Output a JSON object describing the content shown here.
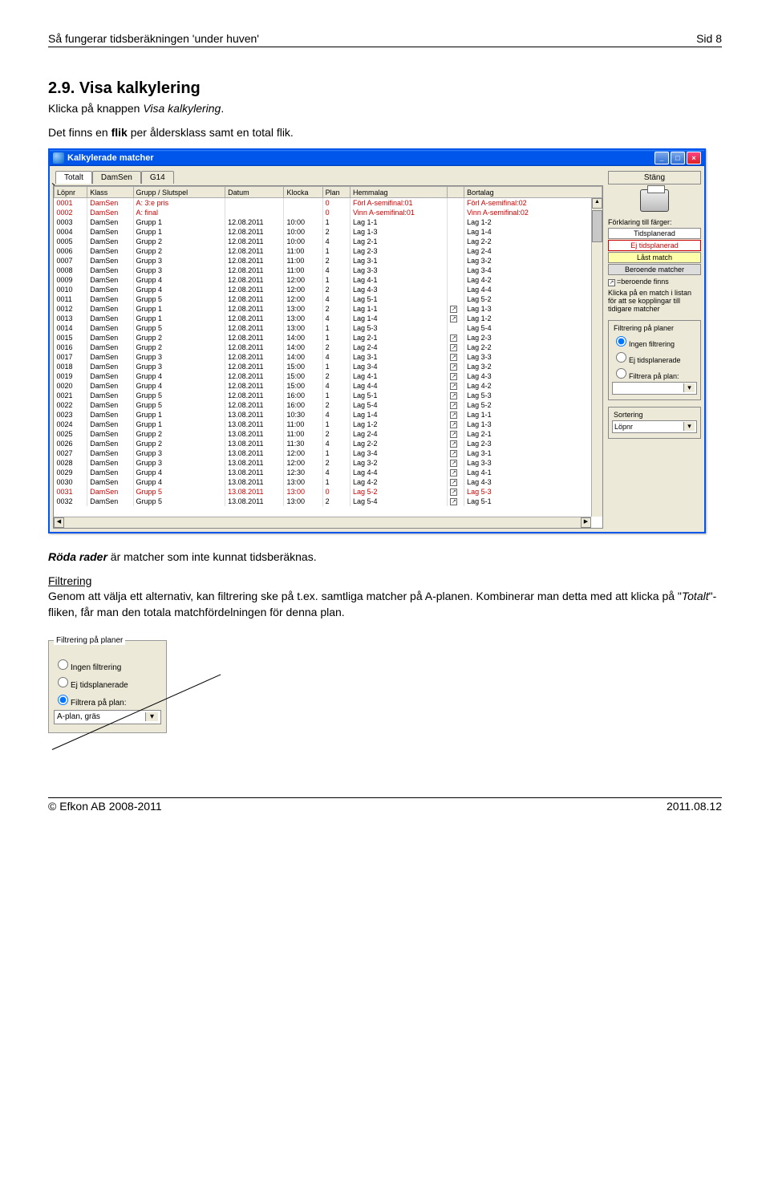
{
  "page": {
    "header_title": "Så fungerar tidsberäkningen 'under huven'",
    "header_page": "Sid 8",
    "footer_left": "© Efkon AB 2008-2011",
    "footer_right": "2011.08.12"
  },
  "section": {
    "heading": "2.9. Visa kalkylering",
    "p1_a": "Klicka på knappen ",
    "p1_b_italic": "Visa kalkylering",
    "p1_c": ".",
    "p2_a": "Det finns en ",
    "p2_b_bold": "flik",
    "p2_c": " per åldersklass samt en total flik.",
    "p3_a_bold_italic": "Röda rader",
    "p3_b": " är matcher som inte kunnat tidsberäknas.",
    "p4_heading": "Filtrering",
    "p4_a": "Genom att välja ett alternativ, kan filtrering ske på t.ex. samtliga matcher på A-planen. Kombinerar man detta med att klicka på \"",
    "p4_b_italic": "Totalt",
    "p4_c": "\"-fliken, får man den totala matchfördelningen för denna plan."
  },
  "window": {
    "title": "Kalkylerade matcher",
    "tabs": [
      "Totalt",
      "DamSen",
      "G14"
    ],
    "close_button": "Stäng",
    "columns": [
      "Löpnr",
      "Klass",
      "Grupp / Slutspel",
      "Datum",
      "Klocka",
      "Plan",
      "Hemmalag",
      "",
      "Bortalag"
    ],
    "rows": [
      {
        "lop": "0001",
        "klass": "DamSen",
        "grupp": "A: 3:e pris",
        "datum": "",
        "klocka": "",
        "plan": "0",
        "hemma": "Förl A-semifinal:01",
        "dep": false,
        "borta": "Förl A-semifinal:02",
        "red": true
      },
      {
        "lop": "0002",
        "klass": "DamSen",
        "grupp": "A: final",
        "datum": "",
        "klocka": "",
        "plan": "0",
        "hemma": "Vinn A-semifinal:01",
        "dep": false,
        "borta": "Vinn A-semifinal:02",
        "red": true
      },
      {
        "lop": "0003",
        "klass": "DamSen",
        "grupp": "Grupp 1",
        "datum": "12.08.2011",
        "klocka": "10:00",
        "plan": "1",
        "hemma": "Lag 1-1",
        "dep": false,
        "borta": "Lag 1-2",
        "red": false
      },
      {
        "lop": "0004",
        "klass": "DamSen",
        "grupp": "Grupp 1",
        "datum": "12.08.2011",
        "klocka": "10:00",
        "plan": "2",
        "hemma": "Lag 1-3",
        "dep": false,
        "borta": "Lag 1-4",
        "red": false
      },
      {
        "lop": "0005",
        "klass": "DamSen",
        "grupp": "Grupp 2",
        "datum": "12.08.2011",
        "klocka": "10:00",
        "plan": "4",
        "hemma": "Lag 2-1",
        "dep": false,
        "borta": "Lag 2-2",
        "red": false
      },
      {
        "lop": "0006",
        "klass": "DamSen",
        "grupp": "Grupp 2",
        "datum": "12.08.2011",
        "klocka": "11:00",
        "plan": "1",
        "hemma": "Lag 2-3",
        "dep": false,
        "borta": "Lag 2-4",
        "red": false
      },
      {
        "lop": "0007",
        "klass": "DamSen",
        "grupp": "Grupp 3",
        "datum": "12.08.2011",
        "klocka": "11:00",
        "plan": "2",
        "hemma": "Lag 3-1",
        "dep": false,
        "borta": "Lag 3-2",
        "red": false
      },
      {
        "lop": "0008",
        "klass": "DamSen",
        "grupp": "Grupp 3",
        "datum": "12.08.2011",
        "klocka": "11:00",
        "plan": "4",
        "hemma": "Lag 3-3",
        "dep": false,
        "borta": "Lag 3-4",
        "red": false
      },
      {
        "lop": "0009",
        "klass": "DamSen",
        "grupp": "Grupp 4",
        "datum": "12.08.2011",
        "klocka": "12:00",
        "plan": "1",
        "hemma": "Lag 4-1",
        "dep": false,
        "borta": "Lag 4-2",
        "red": false
      },
      {
        "lop": "0010",
        "klass": "DamSen",
        "grupp": "Grupp 4",
        "datum": "12.08.2011",
        "klocka": "12:00",
        "plan": "2",
        "hemma": "Lag 4-3",
        "dep": false,
        "borta": "Lag 4-4",
        "red": false
      },
      {
        "lop": "0011",
        "klass": "DamSen",
        "grupp": "Grupp 5",
        "datum": "12.08.2011",
        "klocka": "12:00",
        "plan": "4",
        "hemma": "Lag 5-1",
        "dep": false,
        "borta": "Lag 5-2",
        "red": false
      },
      {
        "lop": "0012",
        "klass": "DamSen",
        "grupp": "Grupp 1",
        "datum": "12.08.2011",
        "klocka": "13:00",
        "plan": "2",
        "hemma": "Lag 1-1",
        "dep": true,
        "borta": "Lag 1-3",
        "red": false
      },
      {
        "lop": "0013",
        "klass": "DamSen",
        "grupp": "Grupp 1",
        "datum": "12.08.2011",
        "klocka": "13:00",
        "plan": "4",
        "hemma": "Lag 1-4",
        "dep": true,
        "borta": "Lag 1-2",
        "red": false
      },
      {
        "lop": "0014",
        "klass": "DamSen",
        "grupp": "Grupp 5",
        "datum": "12.08.2011",
        "klocka": "13:00",
        "plan": "1",
        "hemma": "Lag 5-3",
        "dep": false,
        "borta": "Lag 5-4",
        "red": false
      },
      {
        "lop": "0015",
        "klass": "DamSen",
        "grupp": "Grupp 2",
        "datum": "12.08.2011",
        "klocka": "14:00",
        "plan": "1",
        "hemma": "Lag 2-1",
        "dep": true,
        "borta": "Lag 2-3",
        "red": false
      },
      {
        "lop": "0016",
        "klass": "DamSen",
        "grupp": "Grupp 2",
        "datum": "12.08.2011",
        "klocka": "14:00",
        "plan": "2",
        "hemma": "Lag 2-4",
        "dep": true,
        "borta": "Lag 2-2",
        "red": false
      },
      {
        "lop": "0017",
        "klass": "DamSen",
        "grupp": "Grupp 3",
        "datum": "12.08.2011",
        "klocka": "14:00",
        "plan": "4",
        "hemma": "Lag 3-1",
        "dep": true,
        "borta": "Lag 3-3",
        "red": false
      },
      {
        "lop": "0018",
        "klass": "DamSen",
        "grupp": "Grupp 3",
        "datum": "12.08.2011",
        "klocka": "15:00",
        "plan": "1",
        "hemma": "Lag 3-4",
        "dep": true,
        "borta": "Lag 3-2",
        "red": false
      },
      {
        "lop": "0019",
        "klass": "DamSen",
        "grupp": "Grupp 4",
        "datum": "12.08.2011",
        "klocka": "15:00",
        "plan": "2",
        "hemma": "Lag 4-1",
        "dep": true,
        "borta": "Lag 4-3",
        "red": false
      },
      {
        "lop": "0020",
        "klass": "DamSen",
        "grupp": "Grupp 4",
        "datum": "12.08.2011",
        "klocka": "15:00",
        "plan": "4",
        "hemma": "Lag 4-4",
        "dep": true,
        "borta": "Lag 4-2",
        "red": false
      },
      {
        "lop": "0021",
        "klass": "DamSen",
        "grupp": "Grupp 5",
        "datum": "12.08.2011",
        "klocka": "16:00",
        "plan": "1",
        "hemma": "Lag 5-1",
        "dep": true,
        "borta": "Lag 5-3",
        "red": false
      },
      {
        "lop": "0022",
        "klass": "DamSen",
        "grupp": "Grupp 5",
        "datum": "12.08.2011",
        "klocka": "16:00",
        "plan": "2",
        "hemma": "Lag 5-4",
        "dep": true,
        "borta": "Lag 5-2",
        "red": false
      },
      {
        "lop": "0023",
        "klass": "DamSen",
        "grupp": "Grupp 1",
        "datum": "13.08.2011",
        "klocka": "10:30",
        "plan": "4",
        "hemma": "Lag 1-4",
        "dep": true,
        "borta": "Lag 1-1",
        "red": false
      },
      {
        "lop": "0024",
        "klass": "DamSen",
        "grupp": "Grupp 1",
        "datum": "13.08.2011",
        "klocka": "11:00",
        "plan": "1",
        "hemma": "Lag 1-2",
        "dep": true,
        "borta": "Lag 1-3",
        "red": false
      },
      {
        "lop": "0025",
        "klass": "DamSen",
        "grupp": "Grupp 2",
        "datum": "13.08.2011",
        "klocka": "11:00",
        "plan": "2",
        "hemma": "Lag 2-4",
        "dep": true,
        "borta": "Lag 2-1",
        "red": false
      },
      {
        "lop": "0026",
        "klass": "DamSen",
        "grupp": "Grupp 2",
        "datum": "13.08.2011",
        "klocka": "11:30",
        "plan": "4",
        "hemma": "Lag 2-2",
        "dep": true,
        "borta": "Lag 2-3",
        "red": false
      },
      {
        "lop": "0027",
        "klass": "DamSen",
        "grupp": "Grupp 3",
        "datum": "13.08.2011",
        "klocka": "12:00",
        "plan": "1",
        "hemma": "Lag 3-4",
        "dep": true,
        "borta": "Lag 3-1",
        "red": false
      },
      {
        "lop": "0028",
        "klass": "DamSen",
        "grupp": "Grupp 3",
        "datum": "13.08.2011",
        "klocka": "12:00",
        "plan": "2",
        "hemma": "Lag 3-2",
        "dep": true,
        "borta": "Lag 3-3",
        "red": false
      },
      {
        "lop": "0029",
        "klass": "DamSen",
        "grupp": "Grupp 4",
        "datum": "13.08.2011",
        "klocka": "12:30",
        "plan": "4",
        "hemma": "Lag 4-4",
        "dep": true,
        "borta": "Lag 4-1",
        "red": false
      },
      {
        "lop": "0030",
        "klass": "DamSen",
        "grupp": "Grupp 4",
        "datum": "13.08.2011",
        "klocka": "13:00",
        "plan": "1",
        "hemma": "Lag 4-2",
        "dep": true,
        "borta": "Lag 4-3",
        "red": false
      },
      {
        "lop": "0031",
        "klass": "DamSen",
        "grupp": "Grupp 5",
        "datum": "13.08.2011",
        "klocka": "13:00",
        "plan": "0",
        "hemma": "Lag 5-2",
        "dep": true,
        "borta": "Lag 5-3",
        "red": true
      },
      {
        "lop": "0032",
        "klass": "DamSen",
        "grupp": "Grupp 5",
        "datum": "13.08.2011",
        "klocka": "13:00",
        "plan": "2",
        "hemma": "Lag 5-4",
        "dep": true,
        "borta": "Lag 5-1",
        "red": false
      }
    ],
    "legend": {
      "title": "Förklaring till färger:",
      "planned": "Tidsplanerad",
      "unplanned": "Ej tidsplanerad",
      "locked": "Låst match",
      "dependent": "Beroende matcher",
      "dep_symbol": "↗",
      "dep_text": "=beroende finns",
      "help": "Klicka på en match i listan för att se kopplingar till tidigare matcher"
    },
    "filter": {
      "legend": "Filtrering på planer",
      "opt_none": "Ingen filtrering",
      "opt_unplanned": "Ej tidsplanerade",
      "opt_plan": "Filtrera på plan:",
      "combo_value": ""
    },
    "sort": {
      "legend": "Sortering",
      "combo_value": "Löpnr"
    }
  },
  "filter2": {
    "legend": "Filtrering på planer",
    "opt_none": "Ingen filtrering",
    "opt_unplanned": "Ej tidsplanerade",
    "opt_plan": "Filtrera på plan:",
    "combo_value": "A-plan, gräs"
  }
}
